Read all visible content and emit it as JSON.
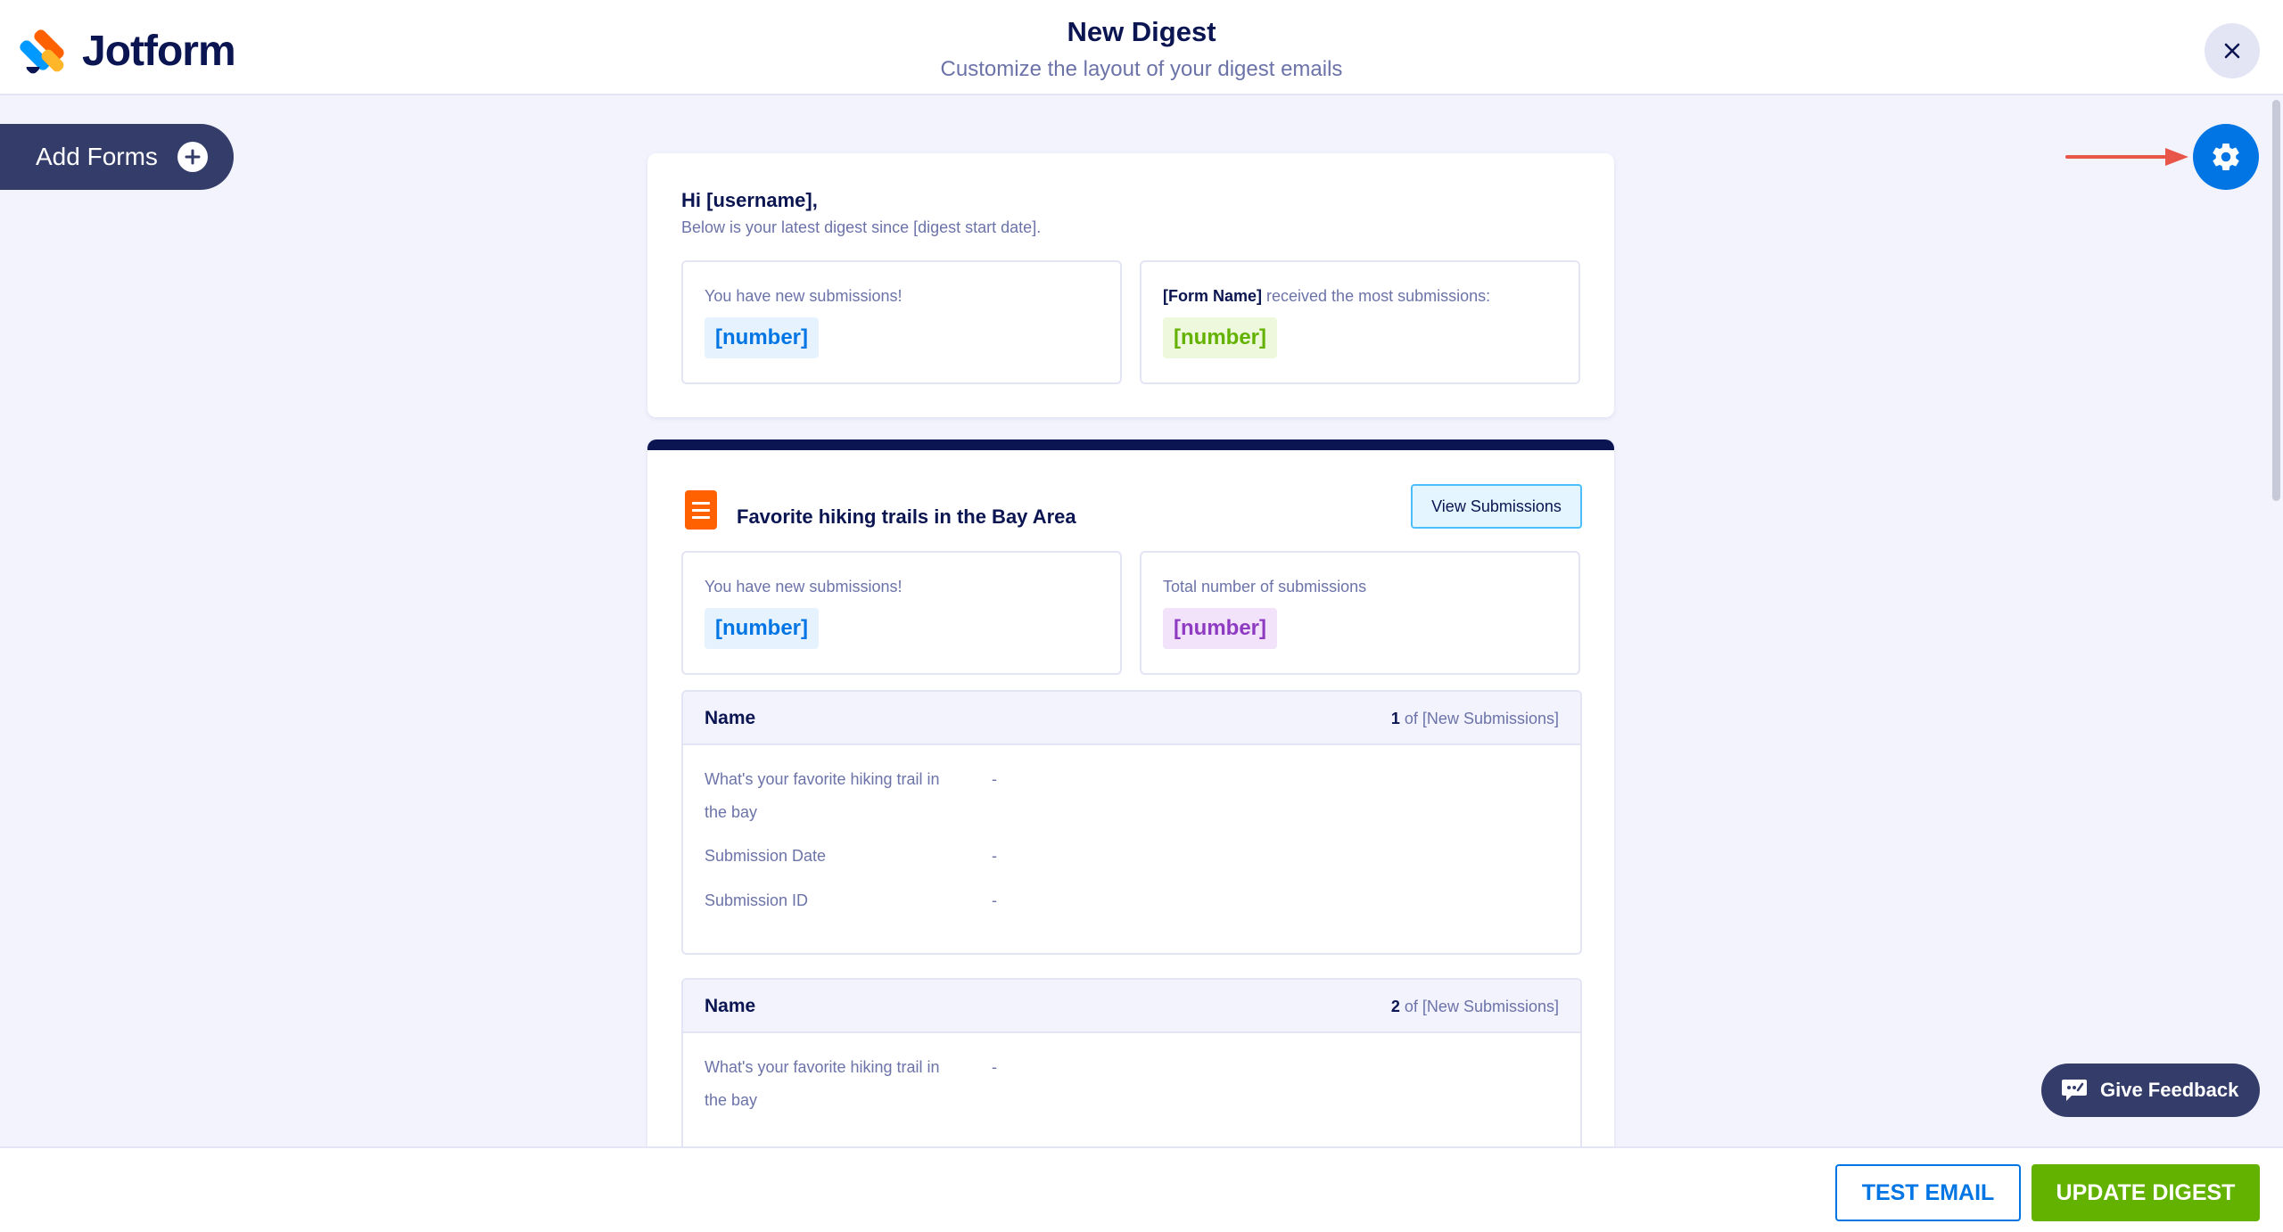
{
  "header": {
    "logo_text": "Jotform",
    "title": "New Digest",
    "subtitle": "Customize the layout of your digest emails",
    "close_icon": "close-icon"
  },
  "sidebar": {
    "add_forms_label": "Add Forms",
    "add_icon": "plus-circle-icon"
  },
  "settings": {
    "icon": "gear-icon"
  },
  "intro": {
    "greeting": "Hi [username],",
    "since_text": "Below is your latest digest since [digest start date].",
    "new_submissions_label": "You have new submissions!",
    "new_submissions_value": "[number]",
    "most_form_name": "[Form Name]",
    "most_label_suffix": " received the most submissions:",
    "most_value": "[number]"
  },
  "form": {
    "title": "Favorite hiking trails in the Bay Area",
    "view_button": "View Submissions",
    "new_label": "You have new submissions!",
    "new_value": "[number]",
    "total_label": "Total number of submissions",
    "total_value": "[number]",
    "submissions": [
      {
        "name": "Name",
        "index": "1",
        "of_text": " of [New Submissions]",
        "fields": [
          {
            "label": "What's your favorite hiking trail in the bay",
            "value": "-"
          },
          {
            "label": "Submission Date",
            "value": "-"
          },
          {
            "label": "Submission ID",
            "value": "-"
          }
        ]
      },
      {
        "name": "Name",
        "index": "2",
        "of_text": " of [New Submissions]",
        "fields": [
          {
            "label": "What's your favorite hiking trail in the bay",
            "value": "-"
          }
        ]
      }
    ]
  },
  "feedback": {
    "label": "Give Feedback",
    "icon": "feedback-chat-icon"
  },
  "footer": {
    "test_email": "TEST EMAIL",
    "update_digest": "UPDATE DIGEST"
  },
  "colors": {
    "brand_navy": "#0a1551",
    "accent_blue": "#0075e3",
    "success_green": "#64b200",
    "pointer_arrow": "#e8564a"
  }
}
